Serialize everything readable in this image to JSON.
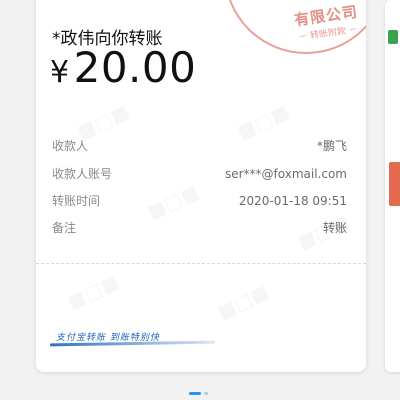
{
  "receipt": {
    "payee": "*政伟向你转账",
    "currency_symbol": "¥",
    "amount": "20.00",
    "rows": [
      {
        "label": "收款人",
        "value": "*鹏飞"
      },
      {
        "label": "收款人账号",
        "value": "ser***@foxmail.com"
      },
      {
        "label": "转账时间",
        "value": "2020-01-18 09:51"
      },
      {
        "label": "备注",
        "value": "转账"
      }
    ],
    "stamp_text": "有限公司",
    "stamp_subtext": "－ 转账附款 －",
    "slogan": "支付宝转账 到账特别快"
  },
  "pager": {
    "total": 2,
    "active": 1
  },
  "colors": {
    "background": "#f2f2f2",
    "card": "#ffffff",
    "stamp": "#d65246",
    "slogan": "#1a62b8",
    "pager_active": "#2196f3",
    "pager_inactive": "#9fd3f0"
  },
  "icons": [
    "watermark-logo",
    "official-seal"
  ]
}
